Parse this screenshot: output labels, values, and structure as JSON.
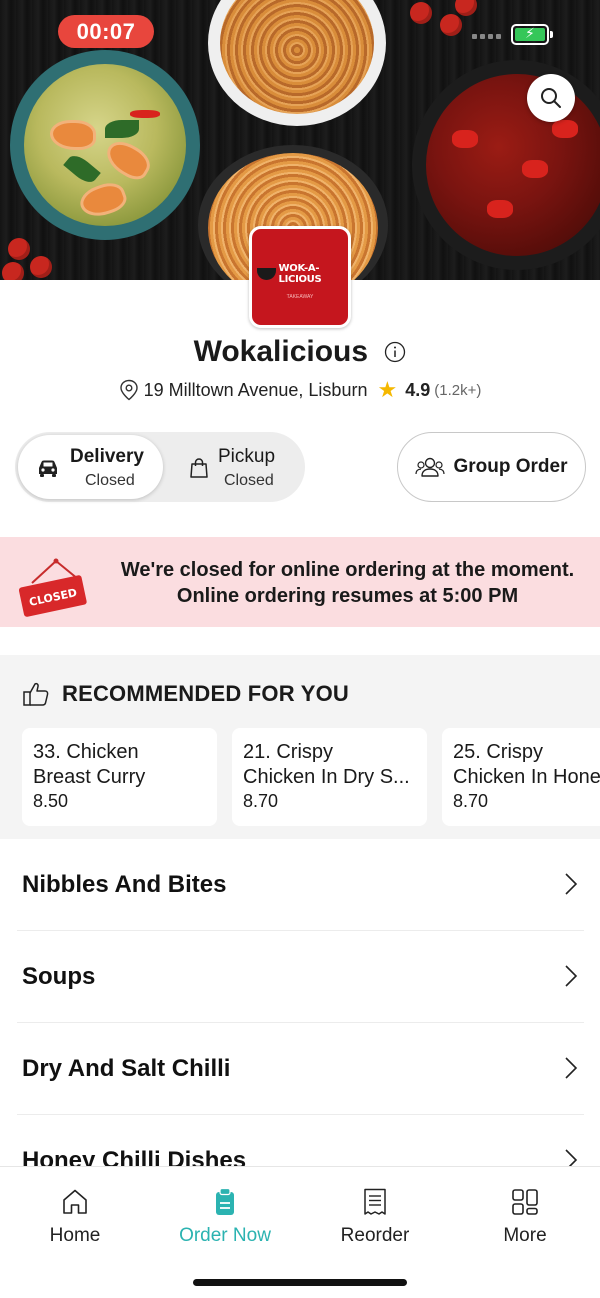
{
  "status_bar": {
    "timer": "00:07"
  },
  "restaurant": {
    "logo_text": "WOK-A-LICIOUS",
    "logo_subtext": "TAKEAWAY",
    "name": "Wokalicious",
    "address": "19 Milltown Avenue, Lisburn",
    "rating": "4.9",
    "rating_count": "(1.2k+)"
  },
  "order_mode": {
    "delivery": {
      "title": "Delivery",
      "status": "Closed",
      "selected": true
    },
    "pickup": {
      "title": "Pickup",
      "status": "Closed",
      "selected": false
    },
    "group_order_label": "Group Order"
  },
  "closed_banner": {
    "sign_text": "CLOSED",
    "line1": "We're closed for online ordering at the moment.",
    "line2": "Online ordering resumes at 5:00 PM"
  },
  "recommended": {
    "heading": "RECOMMENDED FOR YOU",
    "items": [
      {
        "line1": "33. Chicken",
        "line2": "Breast Curry",
        "price": "8.50"
      },
      {
        "line1": "21. Crispy",
        "line2": "Chicken In Dry S...",
        "price": "8.70"
      },
      {
        "line1": "25. Crispy",
        "line2": "Chicken In Honey",
        "price": "8.70"
      }
    ]
  },
  "categories": [
    "Nibbles And Bites",
    "Soups",
    "Dry And Salt Chilli",
    "Honey Chilli Dishes"
  ],
  "tab_bar": {
    "active_color": "#2bb3b1",
    "tabs": [
      {
        "label": "Home",
        "icon": "home-icon",
        "active": false
      },
      {
        "label": "Order Now",
        "icon": "order-icon",
        "active": true
      },
      {
        "label": "Reorder",
        "icon": "receipt-icon",
        "active": false
      },
      {
        "label": "More",
        "icon": "grid-icon",
        "active": false
      }
    ]
  },
  "colors": {
    "closed_banner_bg": "#fbdde0",
    "timer_pill": "#e8463d",
    "logo_bg": "#c5161e",
    "star": "#f5b800"
  }
}
